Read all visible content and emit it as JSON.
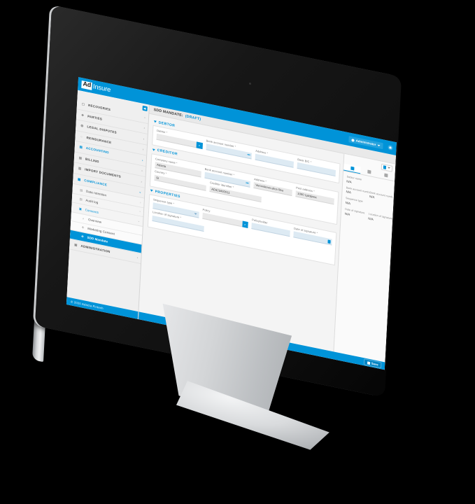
{
  "app": {
    "logo_ad": "Ad",
    "logo_insure": "Insure",
    "user_name": "Administrator",
    "user_icon": "user-icon",
    "bell_icon": "notifications-icon",
    "caret_icon": "chevron-down-icon",
    "accent_color": "#0093d8",
    "footer": "© 2020 Adacta Fintech",
    "collapse_icon": "◀"
  },
  "sidebar": {
    "items": [
      {
        "label": "RECOVERIES",
        "icon": "briefcase-icon",
        "level": 1,
        "chevron": "›",
        "active": false
      },
      {
        "label": "PARTIES",
        "icon": "people-icon",
        "level": 1,
        "chevron": "›",
        "active": false
      },
      {
        "label": "LEGAL DISPUTES",
        "icon": "gavel-icon",
        "level": 1,
        "chevron": "›",
        "active": false
      },
      {
        "label": "REINSURANCE",
        "icon": "refresh-icon",
        "level": 1,
        "chevron": "›",
        "active": false
      },
      {
        "label": "ACCOUNTING",
        "icon": "calculator-icon",
        "level": 1,
        "chevron": "›",
        "active": true
      },
      {
        "label": "BILLING",
        "icon": "invoice-icon",
        "level": 1,
        "chevron": "›",
        "active": false
      },
      {
        "label": "IMPORT DOCUMENTS",
        "icon": "document-icon",
        "level": 1,
        "chevron": "›",
        "active": false
      },
      {
        "label": "COMPLIANCE",
        "icon": "shield-icon",
        "level": 1,
        "chevron": "⌄",
        "active": true
      }
    ],
    "sub_items": [
      {
        "label": "Data retention",
        "icon": "folder-icon",
        "chevron": "›",
        "accent": false
      },
      {
        "label": "Audit log",
        "icon": "folder-icon",
        "chevron": "›",
        "accent": false
      },
      {
        "label": "Consents",
        "icon": "consent-icon",
        "chevron": "⌄",
        "accent": true
      }
    ],
    "sub2_items": [
      {
        "label": "Overview",
        "icon": "search-icon",
        "selected": false
      },
      {
        "label": "Marketing Consent",
        "icon": "plus-icon",
        "selected": false
      },
      {
        "label": "SDD Mandate",
        "icon": "plus-icon",
        "selected": true
      }
    ],
    "bottom_items": [
      {
        "label": "ADMINISTRATION",
        "icon": "settings-icon",
        "chevron": "›"
      }
    ]
  },
  "page": {
    "title": "SDD MANDATE:",
    "status": "(DRAFT)"
  },
  "sections": [
    {
      "name": "DEBTOR",
      "rows": [
        [
          {
            "label": "Debtor",
            "required": true,
            "value": "",
            "style": "grey",
            "widget": "search-button",
            "w": 74
          },
          {
            "label": "Bank account number",
            "required": true,
            "value": "",
            "style": "blue",
            "widget": "dots",
            "w": 74
          },
          {
            "label": "Address",
            "required": true,
            "value": "",
            "style": "blue",
            "widget": "none",
            "w": 62
          },
          {
            "label": "Bank BIC",
            "required": true,
            "value": "",
            "style": "blue",
            "widget": "none",
            "w": 62
          }
        ]
      ]
    },
    {
      "name": "CREDITOR",
      "rows": [
        [
          {
            "label": "Company name",
            "required": true,
            "value": "Adacta",
            "style": "grey",
            "widget": "none",
            "w": 74
          },
          {
            "label": "Bank account number",
            "required": true,
            "value": "",
            "style": "blue",
            "widget": "dots",
            "w": 74
          },
          {
            "label": "Address",
            "required": true,
            "value": "Verovskova ulica 55a",
            "style": "grey",
            "widget": "none",
            "w": 62
          },
          {
            "label": "Post address",
            "required": true,
            "value": "1000 Ljubljana",
            "style": "grey",
            "widget": "none",
            "w": 62
          }
        ],
        [
          {
            "label": "Country",
            "required": true,
            "value": "SI",
            "style": "grey",
            "widget": "none",
            "w": 74
          },
          {
            "label": "Creditor identifier",
            "required": true,
            "value": "AD323492011",
            "style": "grey",
            "widget": "none",
            "w": 74
          }
        ]
      ]
    },
    {
      "name": "PROPERTIES",
      "rows": [
        [
          {
            "label": "Sequence type",
            "required": true,
            "value": "",
            "style": "blue",
            "widget": "caret",
            "w": 74
          },
          {
            "label": "Policy",
            "required": false,
            "value": "",
            "style": "grey",
            "widget": "search-button",
            "w": 74
          },
          {
            "label": "Policyholder",
            "required": false,
            "value": "",
            "style": "blue",
            "widget": "none",
            "w": 62
          },
          {
            "label": "Date of signature",
            "required": true,
            "value": "",
            "style": "blue",
            "widget": "calendar",
            "w": 62
          }
        ],
        [
          {
            "label": "Location of signature",
            "required": true,
            "value": "",
            "style": "blue",
            "widget": "none",
            "w": 74
          }
        ]
      ]
    }
  ],
  "side_panel": {
    "toolbar_icon": "columns-icon",
    "toolbar_caret": "chevron-down-icon",
    "tabs": [
      {
        "icon": "list-icon",
        "active": true
      },
      {
        "icon": "grid-icon",
        "active": false
      },
      {
        "icon": "document-icon",
        "active": false
      }
    ],
    "fields": [
      {
        "label": "Debtor name",
        "value": "N/A",
        "half": false
      },
      {
        "label": "Bank account numb...",
        "value": "N/A",
        "half": true
      },
      {
        "label": "Bank account numb...",
        "value": "N/A",
        "half": true
      },
      {
        "label": "Sequence type",
        "value": "N/A",
        "half": false
      },
      {
        "label": "Date of signature",
        "value": "N/A",
        "half": true
      },
      {
        "label": "Location of signature",
        "value": "N/A",
        "half": true
      }
    ]
  },
  "action_bar": {
    "save_label": "Save",
    "save_icon": "save-icon"
  }
}
